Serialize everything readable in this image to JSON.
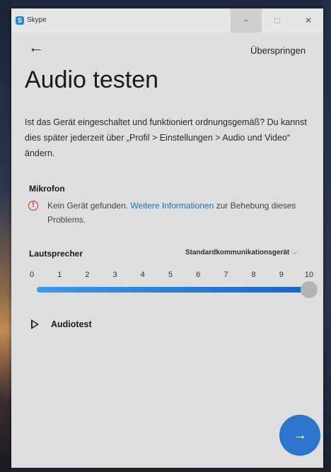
{
  "window": {
    "app_title": "Skype",
    "app_icon_letter": "S",
    "minimize_glyph": "−",
    "maximize_glyph": "□",
    "close_glyph": "✕"
  },
  "header": {
    "back_glyph": "←",
    "skip_label": "Überspringen",
    "title": "Audio testen"
  },
  "intro": {
    "text": "Ist das Gerät eingeschaltet und funktioniert ordnungsgemäß? Du kannst dies später jederzeit über „Profil > Einstellungen > Audio und Video“ ändern."
  },
  "microphone": {
    "label": "Mikrofon",
    "warning_glyph": "!",
    "warning_prefix": "Kein Gerät gefunden.",
    "warning_link": "Weitere Informationen",
    "warning_suffix": "zur Behebung dieses Problems."
  },
  "speaker": {
    "label": "Lautsprecher",
    "device": "Standardkommunikationsgerät",
    "chevron_glyph": "⌵",
    "scale": [
      "0",
      "1",
      "2",
      "3",
      "4",
      "5",
      "6",
      "7",
      "8",
      "9",
      "10"
    ],
    "volume": 10,
    "volume_max": 10
  },
  "audiotest": {
    "label": "Audiotest"
  },
  "next": {
    "glyph": "→"
  },
  "colors": {
    "accent": "#2c74cc",
    "link": "#1a6fc2",
    "warning": "#c9302c"
  }
}
